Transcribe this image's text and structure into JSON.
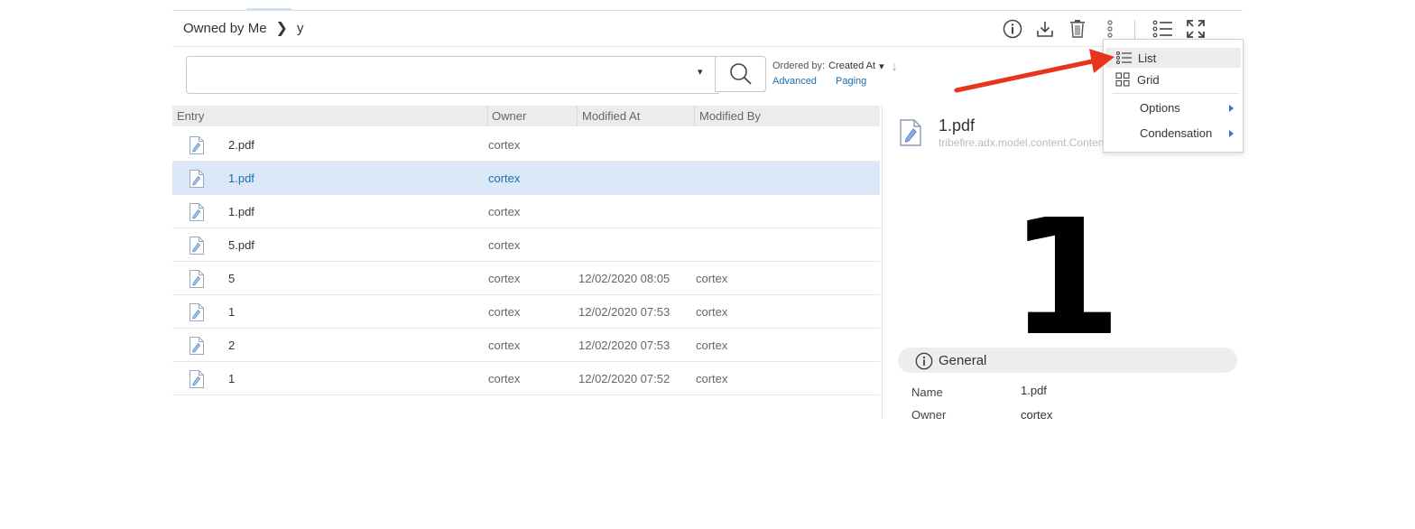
{
  "breadcrumb": {
    "root": "Owned by Me",
    "separator": "❯",
    "current": "y"
  },
  "toolbar": {
    "icons": [
      "info-icon",
      "download-icon",
      "trash-icon",
      "more-vertical-icon",
      "list-view-icon",
      "fullscreen-icon"
    ]
  },
  "search": {
    "value": "",
    "placeholder": "",
    "dropdown_glyph": "▾"
  },
  "ordering": {
    "label": "Ordered by:",
    "value": "Created At",
    "caret": "▾",
    "direction_glyph": "↓"
  },
  "links": {
    "advanced": "Advanced",
    "paging": "Paging"
  },
  "table": {
    "columns": [
      "Entry",
      "Owner",
      "Modified At",
      "Modified By"
    ],
    "rows": [
      {
        "entry": "2.pdf",
        "owner": "cortex",
        "modified_at": "",
        "modified_by": "",
        "selected": false
      },
      {
        "entry": "1.pdf",
        "owner": "cortex",
        "modified_at": "",
        "modified_by": "",
        "selected": true
      },
      {
        "entry": "1.pdf",
        "owner": "cortex",
        "modified_at": "",
        "modified_by": "",
        "selected": false
      },
      {
        "entry": "5.pdf",
        "owner": "cortex",
        "modified_at": "",
        "modified_by": "",
        "selected": false
      },
      {
        "entry": "5",
        "owner": "cortex",
        "modified_at": "12/02/2020 08:05",
        "modified_by": "cortex",
        "selected": false
      },
      {
        "entry": "1",
        "owner": "cortex",
        "modified_at": "12/02/2020 07:53",
        "modified_by": "cortex",
        "selected": false
      },
      {
        "entry": "2",
        "owner": "cortex",
        "modified_at": "12/02/2020 07:53",
        "modified_by": "cortex",
        "selected": false
      },
      {
        "entry": "1",
        "owner": "cortex",
        "modified_at": "12/02/2020 07:52",
        "modified_by": "cortex",
        "selected": false
      }
    ]
  },
  "preview": {
    "name": "1.pdf",
    "type": "tribefire.adx.model.content.Content",
    "thumbnail_text": "1",
    "section": "General",
    "properties": [
      {
        "label": "Name",
        "value": "1.pdf"
      },
      {
        "label": "Owner",
        "value": "cortex"
      }
    ]
  },
  "view_menu": {
    "items": [
      {
        "label": "List",
        "icon": "list-icon",
        "active": true
      },
      {
        "label": "Grid",
        "icon": "grid-icon",
        "active": false
      }
    ],
    "submenus": [
      {
        "label": "Options"
      },
      {
        "label": "Condensation"
      }
    ]
  },
  "annotation": {
    "arrow_color": "#e8341c"
  },
  "colors": {
    "accent": "#1a6fb0",
    "selection": "#dbe8f7",
    "header_bg": "#ececec"
  }
}
